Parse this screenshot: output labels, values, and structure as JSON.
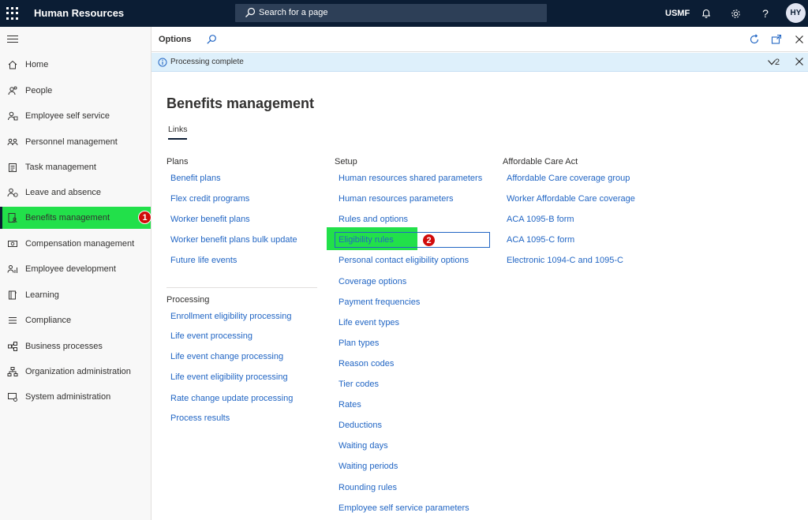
{
  "topbar": {
    "app_title": "Human Resources",
    "search_placeholder": "Search for a page",
    "company": "USMF",
    "avatar_initials": "HY",
    "help_glyph": "?"
  },
  "sidebar": {
    "items": [
      {
        "label": "Home",
        "icon": "home-icon"
      },
      {
        "label": "People",
        "icon": "people-icon"
      },
      {
        "label": "Employee self service",
        "icon": "person-icon"
      },
      {
        "label": "Personnel management",
        "icon": "group-icon"
      },
      {
        "label": "Task management",
        "icon": "clipboard-icon"
      },
      {
        "label": "Leave and absence",
        "icon": "person-clock-icon"
      },
      {
        "label": "Benefits management",
        "icon": "document-person-icon",
        "active": true,
        "badge": "1"
      },
      {
        "label": "Compensation management",
        "icon": "money-icon"
      },
      {
        "label": "Employee development",
        "icon": "person-chart-icon"
      },
      {
        "label": "Learning",
        "icon": "book-icon"
      },
      {
        "label": "Compliance",
        "icon": "list-icon"
      },
      {
        "label": "Business processes",
        "icon": "flow-icon"
      },
      {
        "label": "Organization administration",
        "icon": "org-chart-icon"
      },
      {
        "label": "System administration",
        "icon": "settings-icon"
      }
    ]
  },
  "options": {
    "label": "Options"
  },
  "message": {
    "text": "Processing complete",
    "count": "2"
  },
  "main": {
    "title": "Benefits management",
    "tab": "Links",
    "plans": {
      "title": "Plans",
      "links": [
        "Benefit plans",
        "Flex credit programs",
        "Worker benefit plans",
        "Worker benefit plans bulk update",
        "Future life events"
      ]
    },
    "processing": {
      "title": "Processing",
      "links": [
        "Enrollment eligibility processing",
        "Life event processing",
        "Life event change processing",
        "Life event eligibility processing",
        "Rate change update processing",
        "Process results"
      ]
    },
    "setup": {
      "title": "Setup",
      "links": [
        "Human resources shared parameters",
        "Human resources parameters",
        "Rules and options",
        "Eligibility rules",
        "Personal contact eligibility options",
        "Coverage options",
        "Payment frequencies",
        "Life event types",
        "Plan types",
        "Reason codes",
        "Tier codes",
        "Rates",
        "Deductions",
        "Waiting days",
        "Waiting periods",
        "Rounding rules",
        "Employee self service parameters"
      ],
      "highlight_badge": "2"
    },
    "aca": {
      "title": "Affordable Care Act",
      "links": [
        "Affordable Care coverage group",
        "Worker Affordable Care coverage",
        "ACA 1095-B form",
        "ACA 1095-C form",
        "Electronic 1094-C and 1095-C"
      ]
    }
  },
  "colors": {
    "topbar": "#0b1d34",
    "link": "#2266c4",
    "highlight": "#22e04a",
    "badge": "#d10b0b",
    "message_bg": "#def0fb"
  }
}
